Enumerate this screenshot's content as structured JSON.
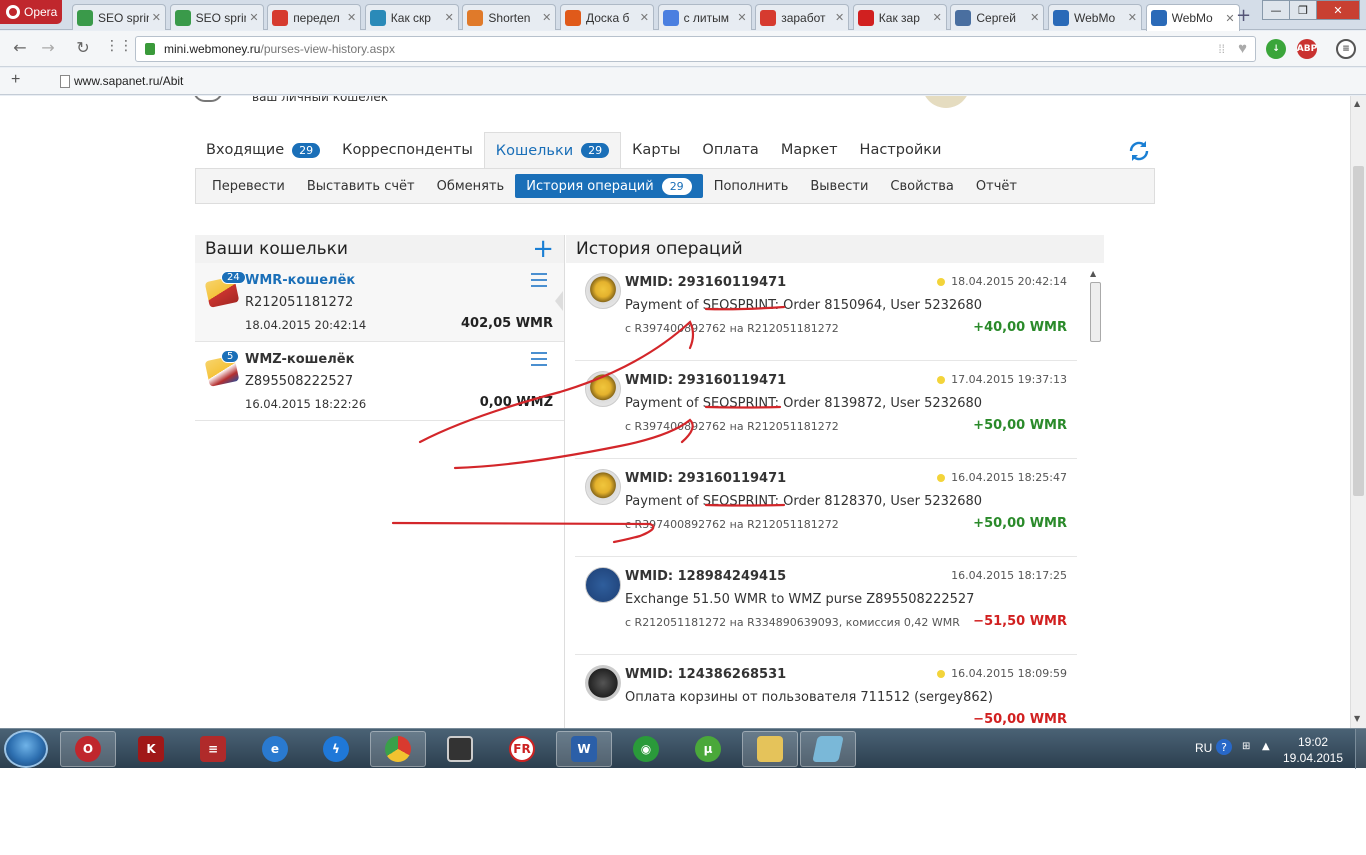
{
  "browser": {
    "menu_label": "Opera",
    "tabs": [
      {
        "title": "SEO sprint",
        "favicon": "seosprint-icon",
        "color": "#3a9a4a"
      },
      {
        "title": "SEO sprint",
        "favicon": "seosprint-icon",
        "color": "#3a9a4a"
      },
      {
        "title": "передел",
        "favicon": "yandex-icon",
        "color": "#d63b2f"
      },
      {
        "title": "Как скр",
        "favicon": "sk-icon",
        "color": "#2a8ab8"
      },
      {
        "title": "Shorten",
        "favicon": "shorten-icon",
        "color": "#e07a2a"
      },
      {
        "title": "Доска б",
        "favicon": "doska-icon",
        "color": "#e05a1a"
      },
      {
        "title": "с литым",
        "favicon": "google-icon",
        "color": "#4a7fe0"
      },
      {
        "title": "заработ",
        "favicon": "yandex-icon",
        "color": "#d63b2f"
      },
      {
        "title": "Как зар",
        "favicon": "play-arrow-icon",
        "color": "#d12020"
      },
      {
        "title": "Сергей",
        "favicon": "vk-icon",
        "color": "#4a6fa0"
      },
      {
        "title": "WebMo",
        "favicon": "webmoney-icon",
        "color": "#2a6ab8"
      },
      {
        "title": "WebMo",
        "favicon": "webmoney-icon",
        "color": "#2a6ab8"
      }
    ],
    "url_host": "mini.webmoney.ru",
    "url_path": "/purses-view-history.aspx",
    "bookmark": "www.sapanet.ru/Abit",
    "extension_abp": "ABP",
    "window_controls": {
      "minimize": "—",
      "maximize": "❐",
      "close": "✕"
    }
  },
  "page": {
    "header_fragment": "ваш личный кошелек",
    "main_tabs": [
      {
        "label": "Входящие",
        "count": "29"
      },
      {
        "label": "Корреспонденты",
        "count": ""
      },
      {
        "label": "Кошельки",
        "count": "29"
      },
      {
        "label": "Карты",
        "count": ""
      },
      {
        "label": "Оплата",
        "count": ""
      },
      {
        "label": "Маркет",
        "count": ""
      },
      {
        "label": "Настройки",
        "count": ""
      }
    ],
    "sub_tabs": [
      {
        "label": "Перевести",
        "count": ""
      },
      {
        "label": "Выставить счёт",
        "count": ""
      },
      {
        "label": "Обменять",
        "count": ""
      },
      {
        "label": "История операций",
        "count": "29"
      },
      {
        "label": "Пополнить",
        "count": ""
      },
      {
        "label": "Вывести",
        "count": ""
      },
      {
        "label": "Свойства",
        "count": ""
      },
      {
        "label": "Отчёт",
        "count": ""
      }
    ],
    "purses_title": "Ваши кошельки",
    "purses": [
      {
        "badge": "24",
        "name": "WMR-кошелёк",
        "number": "R212051181272",
        "date": "18.04.2015 20:42:14",
        "amount": "402,05 WMR"
      },
      {
        "badge": "5",
        "name": "WMZ-кошелёк",
        "number": "Z895508222527",
        "date": "16.04.2015 18:22:26",
        "amount": "0,00 WMZ"
      }
    ],
    "history_title": "История операций",
    "operations": [
      {
        "wmid": "WMID: 293160119471",
        "date": "18.04.2015 20:42:14",
        "desc": "Payment of SEOSPRINT: Order 8150964, User 5232680",
        "from": "с R397400892762 на R212051181272",
        "amount": "+40,00 WMR"
      },
      {
        "wmid": "WMID: 293160119471",
        "date": "17.04.2015 19:37:13",
        "desc": "Payment of SEOSPRINT: Order 8139872, User 5232680",
        "from": "с R397400892762 на R212051181272",
        "amount": "+50,00 WMR"
      },
      {
        "wmid": "WMID: 293160119471",
        "date": "16.04.2015 18:25:47",
        "desc": "Payment of SEOSPRINT: Order 8128370, User 5232680",
        "from": "с R397400892762 на R212051181272",
        "amount": "+50,00 WMR"
      },
      {
        "wmid": "WMID: 128984249415",
        "date": "16.04.2015 18:17:25",
        "desc": "Exchange 51.50 WMR to WMZ purse Z895508222527",
        "from": "с R212051181272 на R334890639093, комиссия 0,42 WMR",
        "amount": "−51,50 WMR"
      },
      {
        "wmid": "WMID: 124386268531",
        "date": "16.04.2015 18:09:59",
        "desc": "Оплата корзины от пользователя 711512 (sergey862)",
        "from": "",
        "amount": "−50,00 WMR"
      }
    ]
  },
  "taskbar": {
    "lang": "RU",
    "time": "19:02",
    "date": "19.04.2015"
  },
  "colors": {
    "accent": "#1a6fb8",
    "positive": "#2a8a2a",
    "negative": "#d12020",
    "annotation": "#d3262a"
  }
}
